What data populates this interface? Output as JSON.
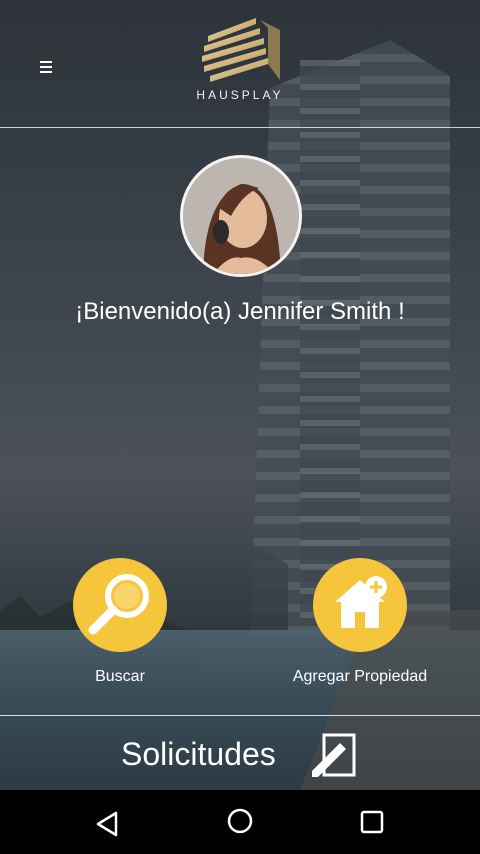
{
  "header": {
    "brand": "HAUSPLAY",
    "menu_icon": "hamburger-menu-icon"
  },
  "profile": {
    "avatar": "user-avatar",
    "welcome": "¡Bienvenido(a) Jennifer Smith !"
  },
  "actions": [
    {
      "label": "Buscar",
      "icon": "magnifier-icon"
    },
    {
      "label": "Agregar Propiedad",
      "icon": "house-add-icon"
    }
  ],
  "solicitudes": {
    "label": "Solicitudes",
    "icon": "edit-document-icon"
  },
  "navigation": {
    "back_icon": "back-triangle-icon",
    "home_icon": "home-circle-icon",
    "recents_icon": "recents-square-icon"
  },
  "colors": {
    "accent": "#F5C53C",
    "text": "#FFFFFF",
    "navbar": "#000000"
  }
}
